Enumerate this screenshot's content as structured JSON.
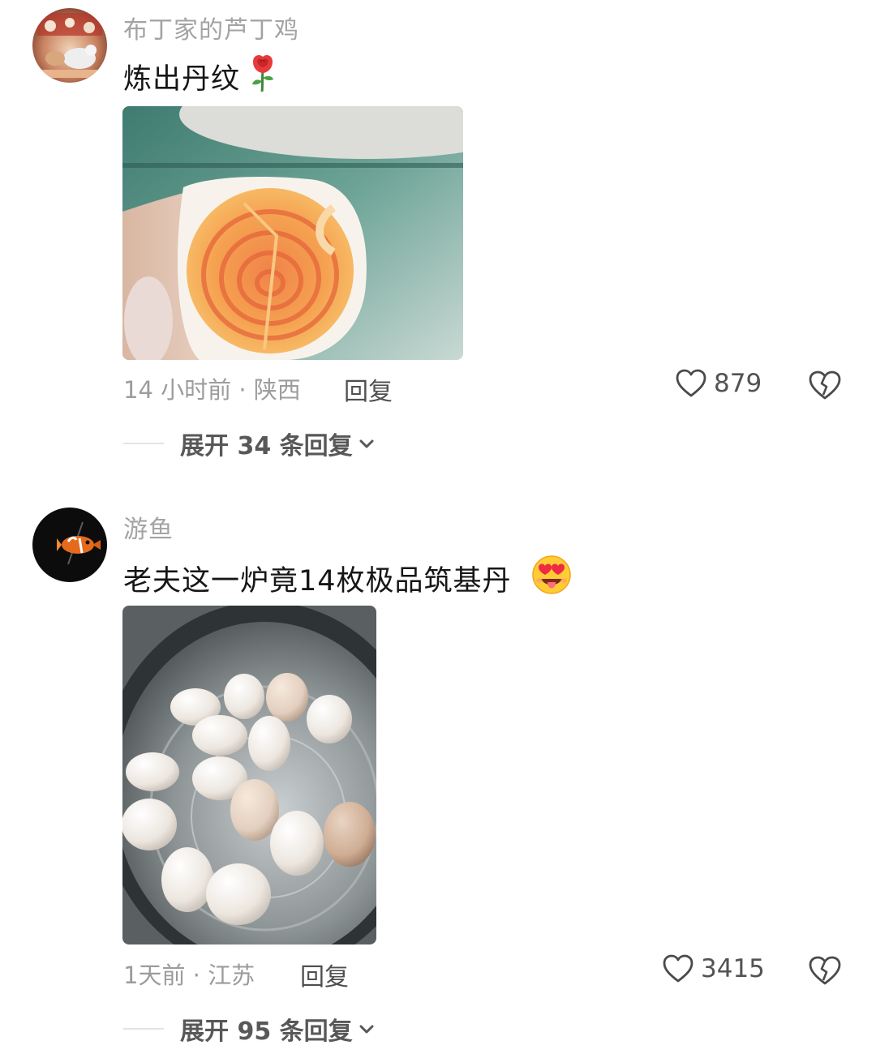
{
  "comments": [
    {
      "username": "布丁家的芦丁鸡",
      "text": "炼出丹纹",
      "emoji": "rose-emoji",
      "time_location": "14 小时前 · 陕西",
      "reply_label": "回复",
      "likes": "879",
      "expand_label": "展开 34 条回复"
    },
    {
      "username": "游鱼",
      "text": "老夫这一炉竟14枚极品筑基丹",
      "emoji": "heart-eyes-tongue-emoji",
      "time_location": "1天前 · 江苏",
      "reply_label": "回复",
      "likes": "3415",
      "expand_label": "展开 95 条回复"
    }
  ],
  "colors": {
    "username": "#a3a3a3",
    "text": "#161616",
    "meta": "#9c9c9c",
    "icon": "#4a4a4a"
  }
}
